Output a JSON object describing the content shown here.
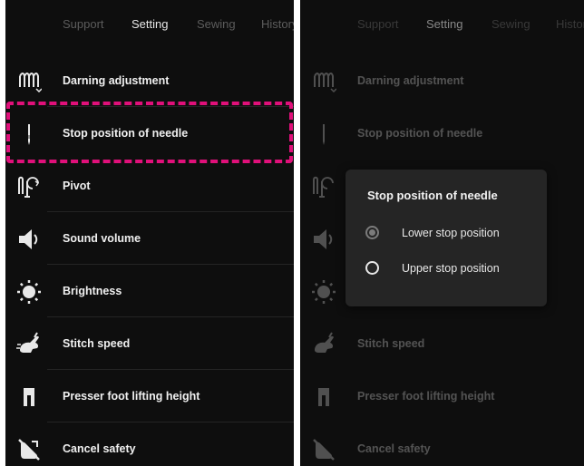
{
  "tabs": [
    "Support",
    "Setting",
    "Sewing",
    "History"
  ],
  "active_tab": "Setting",
  "settings": [
    {
      "label": "Darning adjustment",
      "icon": "darning-icon"
    },
    {
      "label": "Stop position of needle",
      "icon": "needle-icon"
    },
    {
      "label": "Pivot",
      "icon": "pivot-icon"
    },
    {
      "label": "Sound volume",
      "icon": "speaker-icon"
    },
    {
      "label": "Brightness",
      "icon": "sun-icon"
    },
    {
      "label": "Stitch speed",
      "icon": "rabbit-icon"
    },
    {
      "label": "Presser foot lifting height",
      "icon": "presser-foot-icon"
    },
    {
      "label": "Cancel safety",
      "icon": "cancel-safety-icon"
    }
  ],
  "dialog": {
    "title": "Stop position of needle",
    "options": [
      {
        "label": "Lower stop position",
        "selected": true
      },
      {
        "label": "Upper stop position",
        "selected": false
      }
    ]
  },
  "colors": {
    "highlight": "#e0107a",
    "background": "#0e0e0e",
    "dialog": "#252525"
  }
}
